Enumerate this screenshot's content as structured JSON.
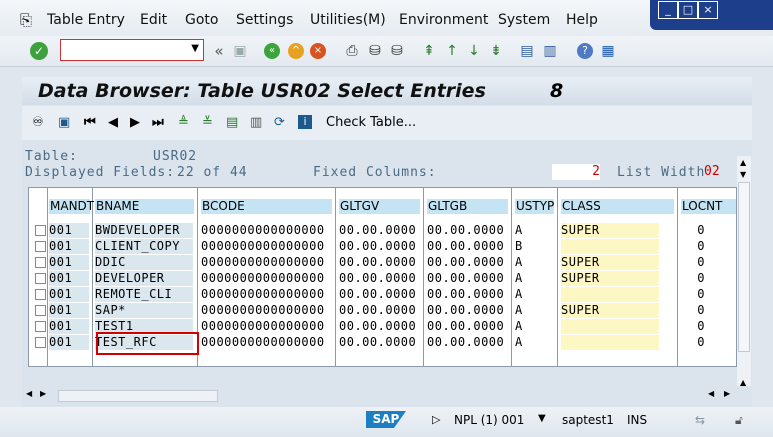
{
  "menu": {
    "items": [
      "Table Entry",
      "Edit",
      "Goto",
      "Settings",
      "Utilities(M)",
      "Environment",
      "System",
      "Help"
    ],
    "menu_icon": "sap-menu-icon"
  },
  "window_controls": {
    "minimize": "_",
    "restore": "□",
    "close": "×"
  },
  "toolbar": {
    "command_field_value": "",
    "icons": [
      "enter-check-icon",
      "back-arrow-icon",
      "exit-icon",
      "cancel-icon",
      "print-icon",
      "find-icon",
      "find-next-icon",
      "first-page-icon",
      "previous-page-icon",
      "next-page-icon",
      "last-page-icon",
      "new-session-icon",
      "shortcut-icon",
      "help-icon",
      "customize-layout-icon"
    ],
    "collapse_label": "«"
  },
  "title": {
    "text": "Data Browser: Table USR02 Select Entries",
    "count": "8"
  },
  "app_toolbar": {
    "check_table_label": "Check Table..."
  },
  "info": {
    "table_label": "Table:",
    "table_value": "USR02",
    "displayed_label": "Displayed Fields:",
    "displayed_value": "22 of  44",
    "fixed_label": "Fixed Columns:",
    "fixed_value": "2",
    "list_width_label": "List Width",
    "list_width_value": "02"
  },
  "table": {
    "columns": [
      "MANDT",
      "BNAME",
      "BCODE",
      "GLTGV",
      "GLTGB",
      "USTYP",
      "CLASS",
      "LOCNT"
    ],
    "rows": [
      [
        "001",
        "BWDEVELOPER",
        "0000000000000000",
        "00.00.0000",
        "00.00.0000",
        "A",
        "SUPER",
        "0"
      ],
      [
        "001",
        "CLIENT_COPY",
        "0000000000000000",
        "00.00.0000",
        "00.00.0000",
        "B",
        "",
        "0"
      ],
      [
        "001",
        "DDIC",
        "0000000000000000",
        "00.00.0000",
        "00.00.0000",
        "A",
        "SUPER",
        "0"
      ],
      [
        "001",
        "DEVELOPER",
        "0000000000000000",
        "00.00.0000",
        "00.00.0000",
        "A",
        "SUPER",
        "0"
      ],
      [
        "001",
        "REMOTE_CLI",
        "0000000000000000",
        "00.00.0000",
        "00.00.0000",
        "A",
        "",
        "0"
      ],
      [
        "001",
        "SAP*",
        "0000000000000000",
        "00.00.0000",
        "00.00.0000",
        "A",
        "SUPER",
        "0"
      ],
      [
        "001",
        "TEST1",
        "0000000000000000",
        "00.00.0000",
        "00.00.0000",
        "A",
        "",
        "0"
      ],
      [
        "001",
        "TEST_RFC",
        "0000000000000000",
        "00.00.0000",
        "00.00.0000",
        "A",
        "",
        "0"
      ]
    ],
    "highlighted_row": 4
  },
  "status": {
    "system": "NPL (1) 001",
    "user": "saptest1",
    "mode": "INS"
  },
  "colors": {
    "highlight_border": "#d40000",
    "key_column_bg": "#dbe7ef",
    "class_column_bg": "#fdf7c3",
    "header_bg": "#c4e4f4"
  }
}
